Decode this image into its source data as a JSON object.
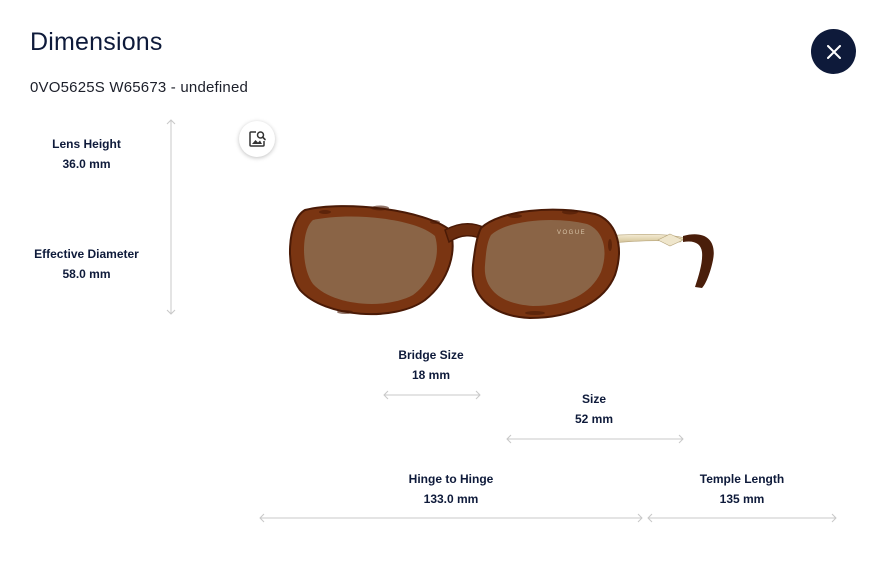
{
  "header": {
    "title": "Dimensions",
    "subtitle": "0VO5625S W65673 - undefined"
  },
  "icons": {
    "close": "close-icon",
    "zoom": "image-search-icon"
  },
  "product": {
    "brand_mark": "VOGUE"
  },
  "measurements": {
    "lens_height": {
      "label": "Lens Height",
      "value": "36.0 mm"
    },
    "effective_diameter": {
      "label": "Effective Diameter",
      "value": "58.0 mm"
    },
    "bridge_size": {
      "label": "Bridge Size",
      "value": "18 mm"
    },
    "size": {
      "label": "Size",
      "value": "52 mm"
    },
    "hinge_to_hinge": {
      "label": "Hinge to Hinge",
      "value": "133.0 mm"
    },
    "temple_length": {
      "label": "Temple Length",
      "value": "135 mm"
    }
  },
  "colors": {
    "navy": "#0e1a3a",
    "arrow": "#c8c8c8",
    "frame": "#7a3512",
    "lens": "#8a6446",
    "temple": "#e9dfc3"
  }
}
